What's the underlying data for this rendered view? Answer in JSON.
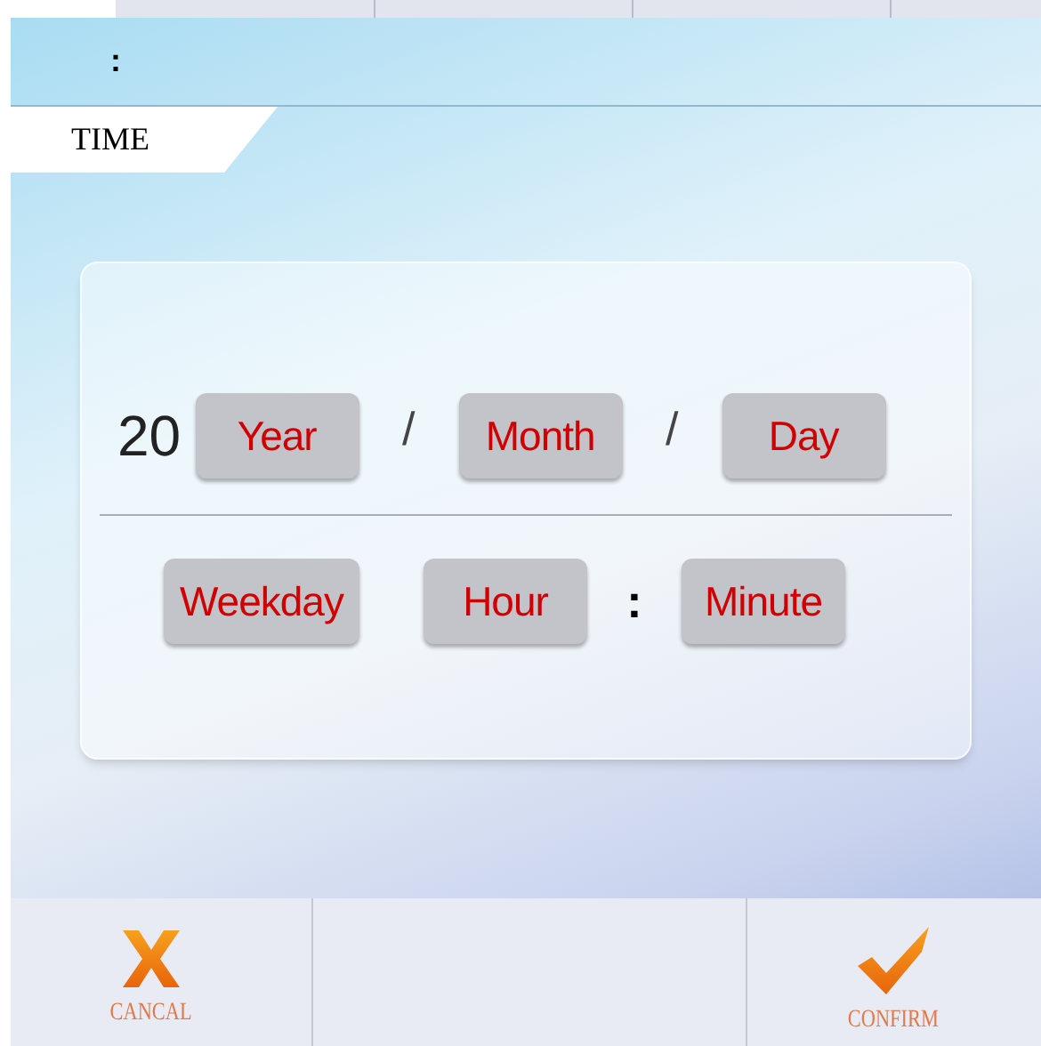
{
  "time_separator": ":",
  "section_label": "TIME",
  "date_row": {
    "prefix": "20",
    "fields": [
      {
        "label": "Year"
      },
      {
        "label": "Month"
      },
      {
        "label": "Day"
      }
    ],
    "separators": [
      "/",
      "/"
    ]
  },
  "time_row": {
    "fields": [
      {
        "label": "Weekday"
      },
      {
        "label": "Hour"
      },
      {
        "label": "Minute"
      }
    ],
    "separator": ":"
  },
  "actions": [
    {
      "kind": "cancel",
      "label": "CANCAL"
    },
    {
      "kind": "confirm",
      "label": "CONFIRM"
    }
  ]
}
